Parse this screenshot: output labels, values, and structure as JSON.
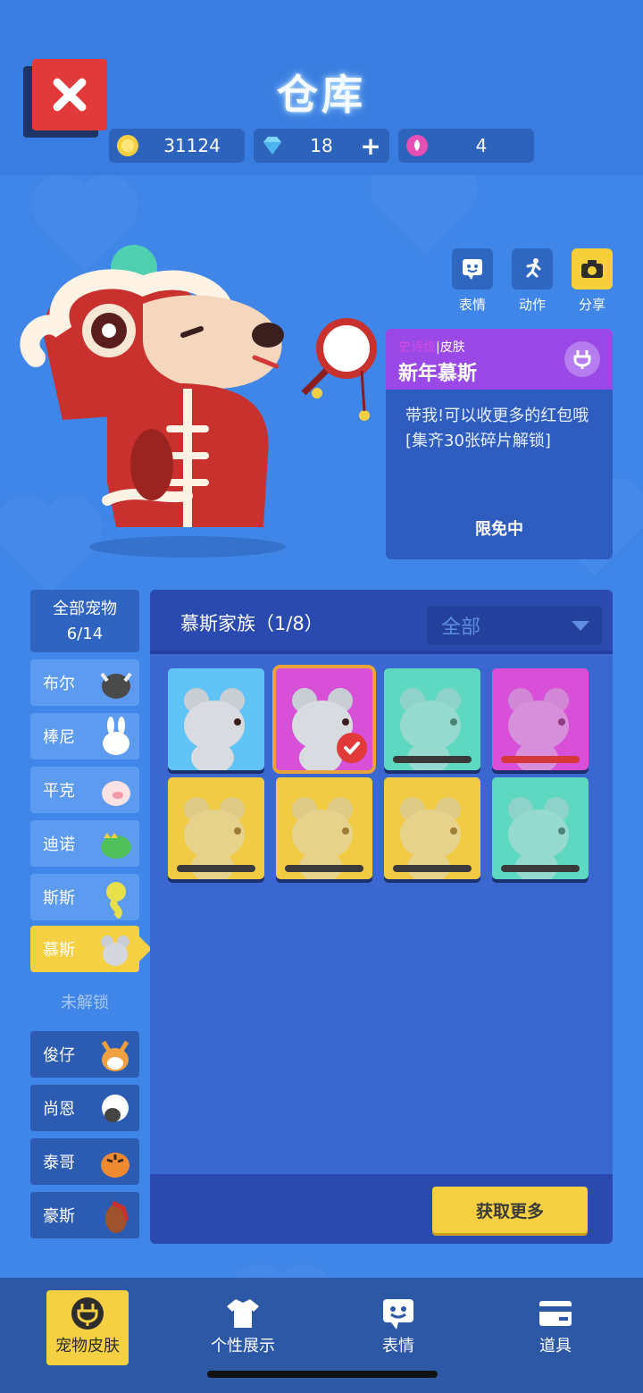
{
  "header": {
    "title": "仓库",
    "close_icon": "close-icon",
    "currencies": [
      {
        "icon": "coin-icon",
        "value": "31124"
      },
      {
        "icon": "diamond-icon",
        "value": "18",
        "plus": "+"
      },
      {
        "icon": "lotus-icon",
        "value": "4"
      }
    ]
  },
  "actions": [
    {
      "icon": "emote-icon",
      "label": "表情"
    },
    {
      "icon": "run-icon",
      "label": "动作"
    },
    {
      "icon": "camera-icon",
      "label": "分享"
    }
  ],
  "info_card": {
    "rarity": "史诗级",
    "type": "皮肤",
    "separator": "|",
    "name": "新年慕斯",
    "description": "带我!可以收更多的红包哦\n[集齐30张碎片解锁]",
    "status": "限免中"
  },
  "sidebar": {
    "all_label": "全部宠物",
    "all_count": "6/14",
    "unlocked": [
      {
        "label": "布尔",
        "pet": "bull"
      },
      {
        "label": "棒尼",
        "pet": "bunny"
      },
      {
        "label": "平克",
        "pet": "pig"
      },
      {
        "label": "迪诺",
        "pet": "dino"
      },
      {
        "label": "斯斯",
        "pet": "snake"
      },
      {
        "label": "慕斯",
        "pet": "mouse"
      }
    ],
    "locked_label": "未解锁",
    "locked": [
      {
        "label": "俊仔",
        "pet": "shiba"
      },
      {
        "label": "尚恩",
        "pet": "sheep"
      },
      {
        "label": "泰哥",
        "pet": "tiger"
      },
      {
        "label": "豪斯",
        "pet": "horse"
      }
    ]
  },
  "panel": {
    "title": "慕斯家族（1/8）",
    "filter": "全部",
    "get_more": "获取更多",
    "skins": [
      {
        "bg": "#5fc3f5",
        "owned": true,
        "selected": false
      },
      {
        "bg": "#d84fd8",
        "owned": true,
        "selected": true
      },
      {
        "bg": "#5fd8c2",
        "owned": false,
        "progress": 0
      },
      {
        "bg": "#d84fd8",
        "owned": false,
        "progress": 0.0
      },
      {
        "bg": "#f2cb45",
        "owned": false,
        "progress": 0
      },
      {
        "bg": "#f2cb45",
        "owned": false,
        "progress": 0
      },
      {
        "bg": "#f2cb45",
        "owned": false,
        "progress": 0
      },
      {
        "bg": "#5fd8c2",
        "owned": false,
        "progress": 0.03
      }
    ]
  },
  "bottom_nav": [
    {
      "label": "宠物皮肤",
      "icon": "plug-icon",
      "active": true
    },
    {
      "label": "个性展示",
      "icon": "shirt-icon",
      "active": false
    },
    {
      "label": "表情",
      "icon": "emote-icon",
      "active": false
    },
    {
      "label": "道具",
      "icon": "card-icon",
      "active": false
    }
  ],
  "colors": {
    "background": "#3f86e8",
    "accent_yellow": "#f6d043",
    "close_red": "#e23a3a",
    "epic_purple": "#9b49e6"
  }
}
